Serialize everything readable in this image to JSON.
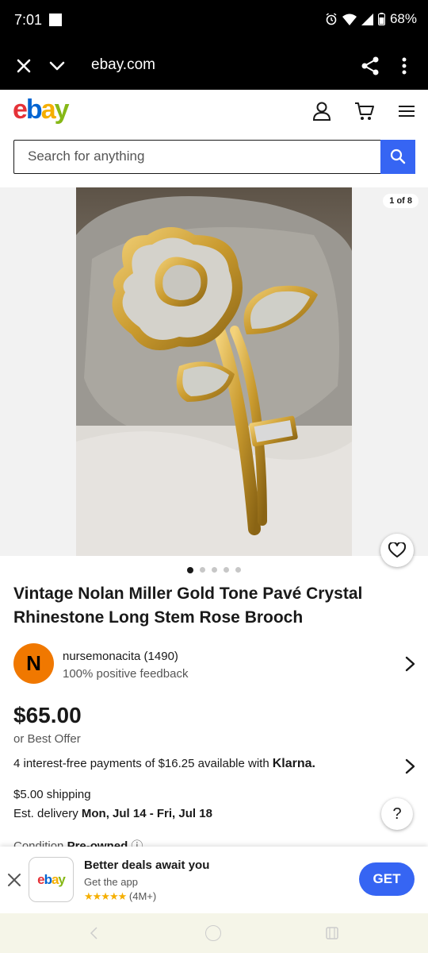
{
  "status": {
    "time": "7:01",
    "battery": "68%"
  },
  "browser": {
    "url": "ebay.com"
  },
  "header": {
    "logo": {
      "e": "e",
      "b": "b",
      "a": "a",
      "y": "y"
    }
  },
  "search": {
    "placeholder": "Search for anything"
  },
  "gallery": {
    "counter": "1 of 8",
    "dots": 5,
    "active_dot": 0
  },
  "listing": {
    "title": "Vintage Nolan Miller Gold Tone Pavé Crystal Rhinestone Long Stem Rose Brooch",
    "price": "$65.00",
    "offer": "or Best Offer",
    "klarna_text": "4 interest-free payments of $16.25 available with",
    "klarna_brand": "Klarna.",
    "shipping": "$5.00 shipping",
    "delivery_label": "Est. delivery",
    "delivery_dates": "Mon, Jul 14 - Fri, Jul 18",
    "condition_label": "Condition",
    "condition_value": "Pre-owned"
  },
  "seller": {
    "initial": "N",
    "name": "nursemonacita (1490)",
    "feedback": "100% positive feedback"
  },
  "help": {
    "label": "?"
  },
  "app_banner": {
    "icon_text": "ebay",
    "title": "Better deals await you",
    "subtitle": "Get the app",
    "stars": "★★★★★",
    "rating_count": "(4M+)",
    "cta": "GET"
  },
  "colors": {
    "accent": "#3665f3",
    "avatar": "#f07800",
    "star": "#f5af02"
  }
}
